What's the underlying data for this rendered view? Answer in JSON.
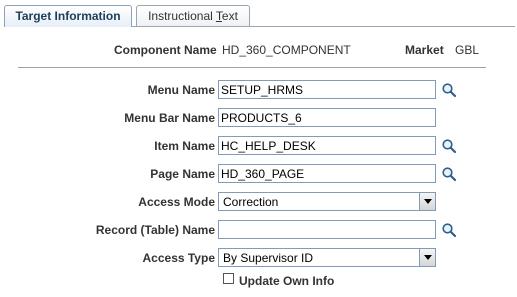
{
  "tabs": [
    {
      "label": "Target Information"
    },
    {
      "label_pre": "Instructional ",
      "label_ul": "T",
      "label_post": "ext"
    }
  ],
  "header": {
    "component_label": "Component Name",
    "component_value": "HD_360_COMPONENT",
    "market_label": "Market",
    "market_value": "GBL"
  },
  "form": {
    "menu_name": {
      "label": "Menu Name",
      "value": "SETUP_HRMS"
    },
    "menu_bar_name": {
      "label": "Menu Bar Name",
      "value": "PRODUCTS_6"
    },
    "item_name": {
      "label": "Item Name",
      "value": "HC_HELP_DESK"
    },
    "page_name": {
      "label": "Page Name",
      "value": "HD_360_PAGE"
    },
    "access_mode": {
      "label": "Access Mode",
      "value": "Correction"
    },
    "record_name": {
      "label": "Record (Table) Name",
      "value": ""
    },
    "access_type": {
      "label": "Access Type",
      "value": "By Supervisor ID"
    },
    "update_own_info": {
      "label": "Update Own Info",
      "checked": false
    }
  },
  "icons": {
    "lookup": "magnifier-icon",
    "dropdown": "chevron-down-icon"
  }
}
